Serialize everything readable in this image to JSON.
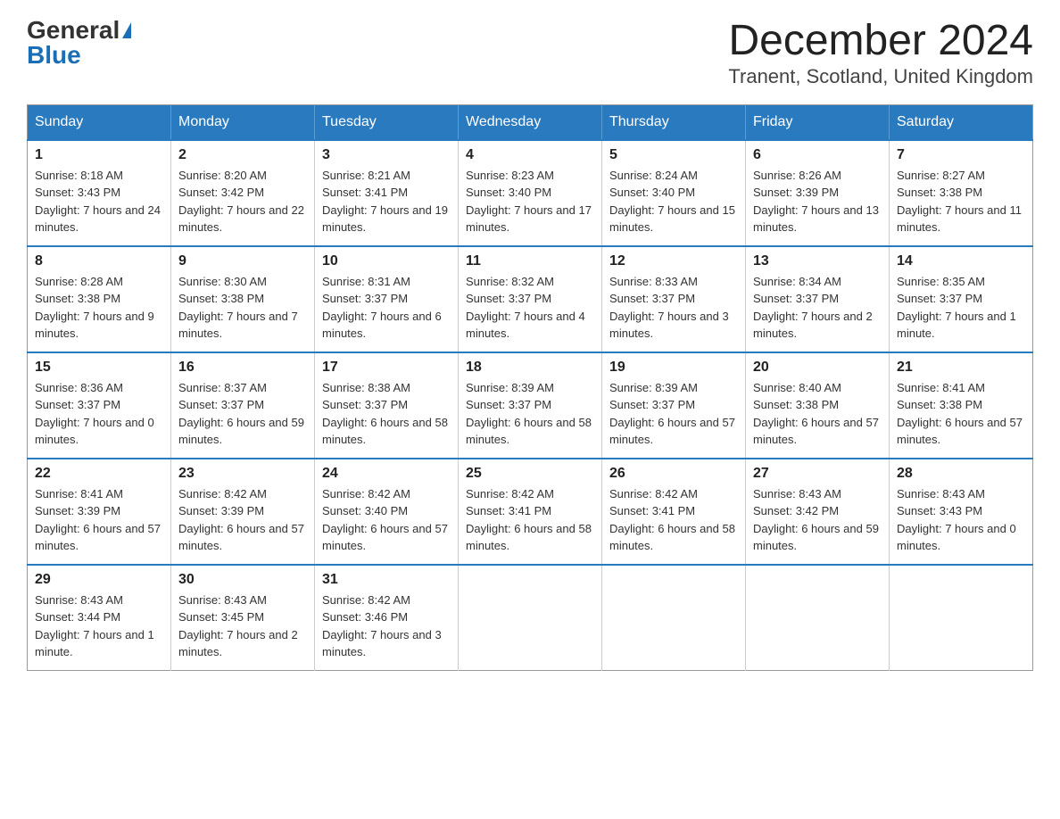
{
  "header": {
    "logo_general": "General",
    "logo_blue": "Blue",
    "month_title": "December 2024",
    "location": "Tranent, Scotland, United Kingdom"
  },
  "days_of_week": [
    "Sunday",
    "Monday",
    "Tuesday",
    "Wednesday",
    "Thursday",
    "Friday",
    "Saturday"
  ],
  "weeks": [
    [
      {
        "day": "1",
        "sunrise": "8:18 AM",
        "sunset": "3:43 PM",
        "daylight": "7 hours and 24 minutes."
      },
      {
        "day": "2",
        "sunrise": "8:20 AM",
        "sunset": "3:42 PM",
        "daylight": "7 hours and 22 minutes."
      },
      {
        "day": "3",
        "sunrise": "8:21 AM",
        "sunset": "3:41 PM",
        "daylight": "7 hours and 19 minutes."
      },
      {
        "day": "4",
        "sunrise": "8:23 AM",
        "sunset": "3:40 PM",
        "daylight": "7 hours and 17 minutes."
      },
      {
        "day": "5",
        "sunrise": "8:24 AM",
        "sunset": "3:40 PM",
        "daylight": "7 hours and 15 minutes."
      },
      {
        "day": "6",
        "sunrise": "8:26 AM",
        "sunset": "3:39 PM",
        "daylight": "7 hours and 13 minutes."
      },
      {
        "day": "7",
        "sunrise": "8:27 AM",
        "sunset": "3:38 PM",
        "daylight": "7 hours and 11 minutes."
      }
    ],
    [
      {
        "day": "8",
        "sunrise": "8:28 AM",
        "sunset": "3:38 PM",
        "daylight": "7 hours and 9 minutes."
      },
      {
        "day": "9",
        "sunrise": "8:30 AM",
        "sunset": "3:38 PM",
        "daylight": "7 hours and 7 minutes."
      },
      {
        "day": "10",
        "sunrise": "8:31 AM",
        "sunset": "3:37 PM",
        "daylight": "7 hours and 6 minutes."
      },
      {
        "day": "11",
        "sunrise": "8:32 AM",
        "sunset": "3:37 PM",
        "daylight": "7 hours and 4 minutes."
      },
      {
        "day": "12",
        "sunrise": "8:33 AM",
        "sunset": "3:37 PM",
        "daylight": "7 hours and 3 minutes."
      },
      {
        "day": "13",
        "sunrise": "8:34 AM",
        "sunset": "3:37 PM",
        "daylight": "7 hours and 2 minutes."
      },
      {
        "day": "14",
        "sunrise": "8:35 AM",
        "sunset": "3:37 PM",
        "daylight": "7 hours and 1 minute."
      }
    ],
    [
      {
        "day": "15",
        "sunrise": "8:36 AM",
        "sunset": "3:37 PM",
        "daylight": "7 hours and 0 minutes."
      },
      {
        "day": "16",
        "sunrise": "8:37 AM",
        "sunset": "3:37 PM",
        "daylight": "6 hours and 59 minutes."
      },
      {
        "day": "17",
        "sunrise": "8:38 AM",
        "sunset": "3:37 PM",
        "daylight": "6 hours and 58 minutes."
      },
      {
        "day": "18",
        "sunrise": "8:39 AM",
        "sunset": "3:37 PM",
        "daylight": "6 hours and 58 minutes."
      },
      {
        "day": "19",
        "sunrise": "8:39 AM",
        "sunset": "3:37 PM",
        "daylight": "6 hours and 57 minutes."
      },
      {
        "day": "20",
        "sunrise": "8:40 AM",
        "sunset": "3:38 PM",
        "daylight": "6 hours and 57 minutes."
      },
      {
        "day": "21",
        "sunrise": "8:41 AM",
        "sunset": "3:38 PM",
        "daylight": "6 hours and 57 minutes."
      }
    ],
    [
      {
        "day": "22",
        "sunrise": "8:41 AM",
        "sunset": "3:39 PM",
        "daylight": "6 hours and 57 minutes."
      },
      {
        "day": "23",
        "sunrise": "8:42 AM",
        "sunset": "3:39 PM",
        "daylight": "6 hours and 57 minutes."
      },
      {
        "day": "24",
        "sunrise": "8:42 AM",
        "sunset": "3:40 PM",
        "daylight": "6 hours and 57 minutes."
      },
      {
        "day": "25",
        "sunrise": "8:42 AM",
        "sunset": "3:41 PM",
        "daylight": "6 hours and 58 minutes."
      },
      {
        "day": "26",
        "sunrise": "8:42 AM",
        "sunset": "3:41 PM",
        "daylight": "6 hours and 58 minutes."
      },
      {
        "day": "27",
        "sunrise": "8:43 AM",
        "sunset": "3:42 PM",
        "daylight": "6 hours and 59 minutes."
      },
      {
        "day": "28",
        "sunrise": "8:43 AM",
        "sunset": "3:43 PM",
        "daylight": "7 hours and 0 minutes."
      }
    ],
    [
      {
        "day": "29",
        "sunrise": "8:43 AM",
        "sunset": "3:44 PM",
        "daylight": "7 hours and 1 minute."
      },
      {
        "day": "30",
        "sunrise": "8:43 AM",
        "sunset": "3:45 PM",
        "daylight": "7 hours and 2 minutes."
      },
      {
        "day": "31",
        "sunrise": "8:42 AM",
        "sunset": "3:46 PM",
        "daylight": "7 hours and 3 minutes."
      },
      null,
      null,
      null,
      null
    ]
  ]
}
